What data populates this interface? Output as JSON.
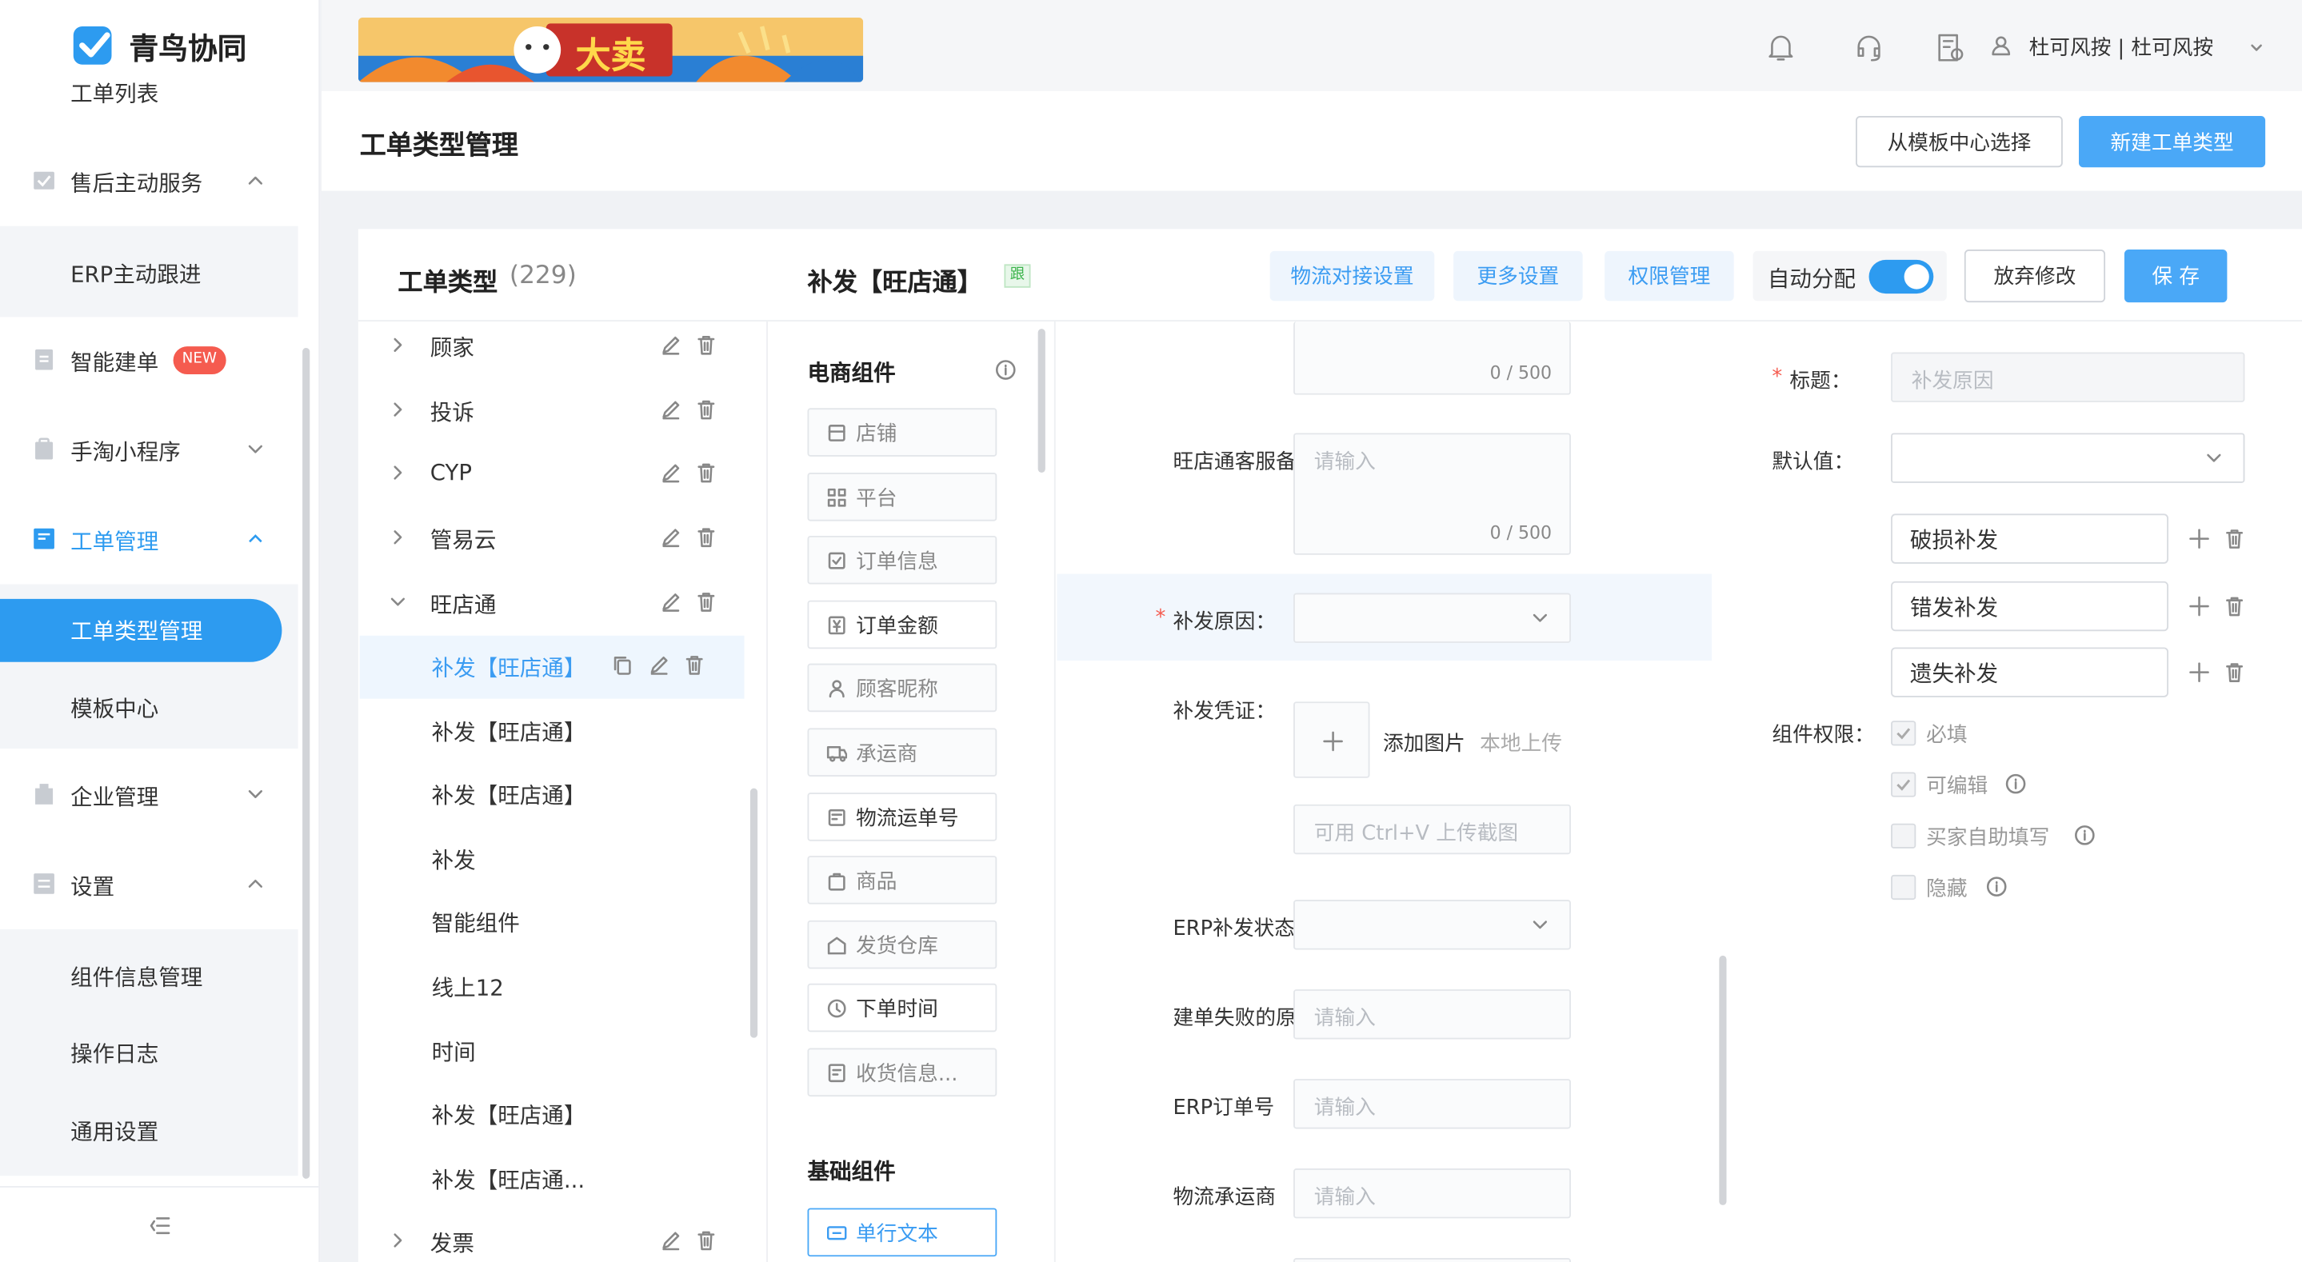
{
  "app": {
    "name": "青鸟协同"
  },
  "header": {
    "user": "杜可风按 | 杜可风按",
    "banner_text": "大卖"
  },
  "sidebar": {
    "partial_item": "工单列表",
    "items": [
      {
        "label": "售后主动服务"
      },
      {
        "label": "智能建单",
        "badge": "NEW"
      },
      {
        "label": "手淘小程序"
      },
      {
        "label": "工单管理"
      },
      {
        "label": "企业管理"
      },
      {
        "label": "设置"
      }
    ],
    "sub_after_service": [
      "ERP主动跟进"
    ],
    "sub_ticket": [
      "工单类型管理",
      "模板中心"
    ],
    "sub_settings": [
      "组件信息管理",
      "操作日志",
      "通用设置"
    ]
  },
  "page": {
    "title": "工单类型管理",
    "btn_template": "从模板中心选择",
    "btn_new": "新建工单类型"
  },
  "types_panel": {
    "title": "工单类型",
    "count": "(229)"
  },
  "tree": [
    {
      "label": "顾家"
    },
    {
      "label": "投诉"
    },
    {
      "label": "CYP"
    },
    {
      "label": "管易云"
    },
    {
      "label": "旺店通"
    },
    {
      "label": "补发【旺店通】"
    },
    {
      "label": "补发【旺店通】"
    },
    {
      "label": "补发【旺店通】"
    },
    {
      "label": "补发"
    },
    {
      "label": "智能组件"
    },
    {
      "label": "线上12"
    },
    {
      "label": "时间"
    },
    {
      "label": "补发【旺店通】"
    },
    {
      "label": "补发【旺店通..."
    },
    {
      "label": "发票"
    }
  ],
  "editor": {
    "title": "补发【旺店通】",
    "tag": "跟",
    "tabs": [
      "物流对接设置",
      "更多设置",
      "权限管理"
    ],
    "auto_assign": "自动分配",
    "btn_discard": "放弃修改",
    "btn_save": "保 存"
  },
  "components": {
    "ecommerce_title": "电商组件",
    "ecommerce": [
      "店铺",
      "平台",
      "订单信息",
      "订单金额",
      "顾客昵称",
      "承运商",
      "物流运单号",
      "商品",
      "发货仓库",
      "下单时间",
      "收货信息..."
    ],
    "basic_title": "基础组件",
    "basic": [
      "单行文本"
    ]
  },
  "form": {
    "counter1": "0 / 500",
    "f1_label": "旺店通客服备注",
    "f1_placeholder": "请输入",
    "f1_counter": "0 / 500",
    "f2_required": "*",
    "f2_label": "补发原因：",
    "f3_label": "补发凭证：",
    "add_image": "添加图片",
    "local_upload": "本地上传",
    "paste_hint": "可用 Ctrl+V 上传截图",
    "f4_label": "ERP补发状态",
    "f5_label": "建单失败的原因",
    "f5_placeholder": "请输入",
    "f6_label": "ERP订单号",
    "f6_placeholder": "请输入",
    "f7_label": "物流承运商",
    "f7_placeholder": "请输入"
  },
  "props": {
    "title_required": "*",
    "title_label": "标题：",
    "title_value": "补发原因",
    "default_label": "默认值：",
    "options": [
      "破损补发",
      "错发补发",
      "遗失补发"
    ],
    "perm_label": "组件权限：",
    "perms": [
      {
        "label": "必填",
        "checked": true
      },
      {
        "label": "可编辑",
        "checked": true
      },
      {
        "label": "买家自助填写",
        "checked": false
      },
      {
        "label": "隐藏",
        "checked": false
      }
    ]
  },
  "colors": {
    "primary": "#4aa8f7",
    "active_nav": "#2d9bf0",
    "danger": "#f55b4f"
  }
}
